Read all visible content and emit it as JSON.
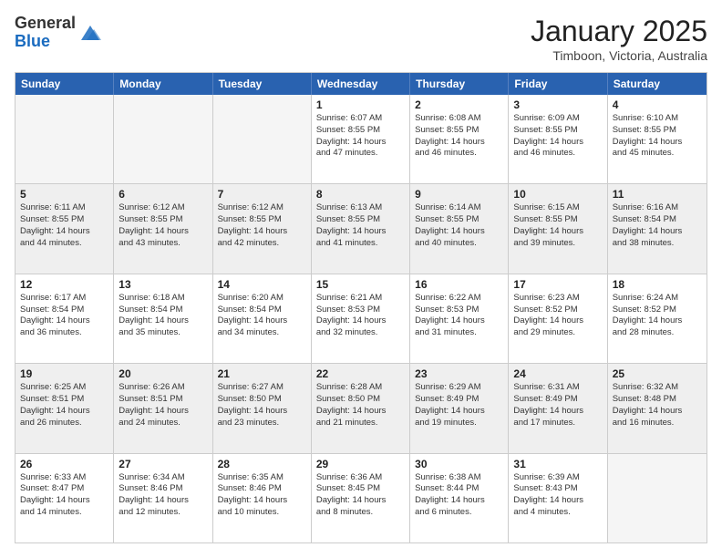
{
  "logo": {
    "general": "General",
    "blue": "Blue"
  },
  "header": {
    "month": "January 2025",
    "location": "Timboon, Victoria, Australia"
  },
  "weekdays": [
    "Sunday",
    "Monday",
    "Tuesday",
    "Wednesday",
    "Thursday",
    "Friday",
    "Saturday"
  ],
  "rows": [
    {
      "shaded": false,
      "cells": [
        {
          "day": "",
          "empty": true,
          "lines": []
        },
        {
          "day": "",
          "empty": true,
          "lines": []
        },
        {
          "day": "",
          "empty": true,
          "lines": []
        },
        {
          "day": "1",
          "empty": false,
          "lines": [
            "Sunrise: 6:07 AM",
            "Sunset: 8:55 PM",
            "Daylight: 14 hours",
            "and 47 minutes."
          ]
        },
        {
          "day": "2",
          "empty": false,
          "lines": [
            "Sunrise: 6:08 AM",
            "Sunset: 8:55 PM",
            "Daylight: 14 hours",
            "and 46 minutes."
          ]
        },
        {
          "day": "3",
          "empty": false,
          "lines": [
            "Sunrise: 6:09 AM",
            "Sunset: 8:55 PM",
            "Daylight: 14 hours",
            "and 46 minutes."
          ]
        },
        {
          "day": "4",
          "empty": false,
          "lines": [
            "Sunrise: 6:10 AM",
            "Sunset: 8:55 PM",
            "Daylight: 14 hours",
            "and 45 minutes."
          ]
        }
      ]
    },
    {
      "shaded": true,
      "cells": [
        {
          "day": "5",
          "empty": false,
          "lines": [
            "Sunrise: 6:11 AM",
            "Sunset: 8:55 PM",
            "Daylight: 14 hours",
            "and 44 minutes."
          ]
        },
        {
          "day": "6",
          "empty": false,
          "lines": [
            "Sunrise: 6:12 AM",
            "Sunset: 8:55 PM",
            "Daylight: 14 hours",
            "and 43 minutes."
          ]
        },
        {
          "day": "7",
          "empty": false,
          "lines": [
            "Sunrise: 6:12 AM",
            "Sunset: 8:55 PM",
            "Daylight: 14 hours",
            "and 42 minutes."
          ]
        },
        {
          "day": "8",
          "empty": false,
          "lines": [
            "Sunrise: 6:13 AM",
            "Sunset: 8:55 PM",
            "Daylight: 14 hours",
            "and 41 minutes."
          ]
        },
        {
          "day": "9",
          "empty": false,
          "lines": [
            "Sunrise: 6:14 AM",
            "Sunset: 8:55 PM",
            "Daylight: 14 hours",
            "and 40 minutes."
          ]
        },
        {
          "day": "10",
          "empty": false,
          "lines": [
            "Sunrise: 6:15 AM",
            "Sunset: 8:55 PM",
            "Daylight: 14 hours",
            "and 39 minutes."
          ]
        },
        {
          "day": "11",
          "empty": false,
          "lines": [
            "Sunrise: 6:16 AM",
            "Sunset: 8:54 PM",
            "Daylight: 14 hours",
            "and 38 minutes."
          ]
        }
      ]
    },
    {
      "shaded": false,
      "cells": [
        {
          "day": "12",
          "empty": false,
          "lines": [
            "Sunrise: 6:17 AM",
            "Sunset: 8:54 PM",
            "Daylight: 14 hours",
            "and 36 minutes."
          ]
        },
        {
          "day": "13",
          "empty": false,
          "lines": [
            "Sunrise: 6:18 AM",
            "Sunset: 8:54 PM",
            "Daylight: 14 hours",
            "and 35 minutes."
          ]
        },
        {
          "day": "14",
          "empty": false,
          "lines": [
            "Sunrise: 6:20 AM",
            "Sunset: 8:54 PM",
            "Daylight: 14 hours",
            "and 34 minutes."
          ]
        },
        {
          "day": "15",
          "empty": false,
          "lines": [
            "Sunrise: 6:21 AM",
            "Sunset: 8:53 PM",
            "Daylight: 14 hours",
            "and 32 minutes."
          ]
        },
        {
          "day": "16",
          "empty": false,
          "lines": [
            "Sunrise: 6:22 AM",
            "Sunset: 8:53 PM",
            "Daylight: 14 hours",
            "and 31 minutes."
          ]
        },
        {
          "day": "17",
          "empty": false,
          "lines": [
            "Sunrise: 6:23 AM",
            "Sunset: 8:52 PM",
            "Daylight: 14 hours",
            "and 29 minutes."
          ]
        },
        {
          "day": "18",
          "empty": false,
          "lines": [
            "Sunrise: 6:24 AM",
            "Sunset: 8:52 PM",
            "Daylight: 14 hours",
            "and 28 minutes."
          ]
        }
      ]
    },
    {
      "shaded": true,
      "cells": [
        {
          "day": "19",
          "empty": false,
          "lines": [
            "Sunrise: 6:25 AM",
            "Sunset: 8:51 PM",
            "Daylight: 14 hours",
            "and 26 minutes."
          ]
        },
        {
          "day": "20",
          "empty": false,
          "lines": [
            "Sunrise: 6:26 AM",
            "Sunset: 8:51 PM",
            "Daylight: 14 hours",
            "and 24 minutes."
          ]
        },
        {
          "day": "21",
          "empty": false,
          "lines": [
            "Sunrise: 6:27 AM",
            "Sunset: 8:50 PM",
            "Daylight: 14 hours",
            "and 23 minutes."
          ]
        },
        {
          "day": "22",
          "empty": false,
          "lines": [
            "Sunrise: 6:28 AM",
            "Sunset: 8:50 PM",
            "Daylight: 14 hours",
            "and 21 minutes."
          ]
        },
        {
          "day": "23",
          "empty": false,
          "lines": [
            "Sunrise: 6:29 AM",
            "Sunset: 8:49 PM",
            "Daylight: 14 hours",
            "and 19 minutes."
          ]
        },
        {
          "day": "24",
          "empty": false,
          "lines": [
            "Sunrise: 6:31 AM",
            "Sunset: 8:49 PM",
            "Daylight: 14 hours",
            "and 17 minutes."
          ]
        },
        {
          "day": "25",
          "empty": false,
          "lines": [
            "Sunrise: 6:32 AM",
            "Sunset: 8:48 PM",
            "Daylight: 14 hours",
            "and 16 minutes."
          ]
        }
      ]
    },
    {
      "shaded": false,
      "cells": [
        {
          "day": "26",
          "empty": false,
          "lines": [
            "Sunrise: 6:33 AM",
            "Sunset: 8:47 PM",
            "Daylight: 14 hours",
            "and 14 minutes."
          ]
        },
        {
          "day": "27",
          "empty": false,
          "lines": [
            "Sunrise: 6:34 AM",
            "Sunset: 8:46 PM",
            "Daylight: 14 hours",
            "and 12 minutes."
          ]
        },
        {
          "day": "28",
          "empty": false,
          "lines": [
            "Sunrise: 6:35 AM",
            "Sunset: 8:46 PM",
            "Daylight: 14 hours",
            "and 10 minutes."
          ]
        },
        {
          "day": "29",
          "empty": false,
          "lines": [
            "Sunrise: 6:36 AM",
            "Sunset: 8:45 PM",
            "Daylight: 14 hours",
            "and 8 minutes."
          ]
        },
        {
          "day": "30",
          "empty": false,
          "lines": [
            "Sunrise: 6:38 AM",
            "Sunset: 8:44 PM",
            "Daylight: 14 hours",
            "and 6 minutes."
          ]
        },
        {
          "day": "31",
          "empty": false,
          "lines": [
            "Sunrise: 6:39 AM",
            "Sunset: 8:43 PM",
            "Daylight: 14 hours",
            "and 4 minutes."
          ]
        },
        {
          "day": "",
          "empty": true,
          "lines": []
        }
      ]
    }
  ]
}
